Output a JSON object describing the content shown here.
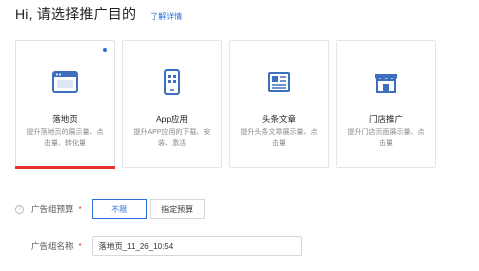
{
  "header": {
    "title": "Hi, 请选择推广目的",
    "detail_link": "了解详情"
  },
  "cards": [
    {
      "title": "落地页",
      "desc": "提升落地页的展示量、点击量、转化量",
      "icon": "landing-page-icon",
      "selected": true
    },
    {
      "title": "App应用",
      "desc": "提升APP应用的下载、安装、激活",
      "icon": "mobile-app-icon",
      "selected": false
    },
    {
      "title": "头条文章",
      "desc": "提升头条文章展示量、点击量",
      "icon": "article-icon",
      "selected": false
    },
    {
      "title": "门店推广",
      "desc": "提升门店页面展示量、点击量",
      "icon": "store-icon",
      "selected": false
    }
  ],
  "form": {
    "budget_label": "广告组预算",
    "budget_required": "*",
    "budget_options": [
      "不限",
      "指定预算"
    ],
    "budget_selected": "不限",
    "name_label": "广告组名称",
    "name_required": "*",
    "name_value": "落地页_11_26_10:54"
  },
  "colors": {
    "accent": "#2b6fd6",
    "selected_underline": "#e8312f",
    "icon_blue": "#3d6fbf"
  }
}
